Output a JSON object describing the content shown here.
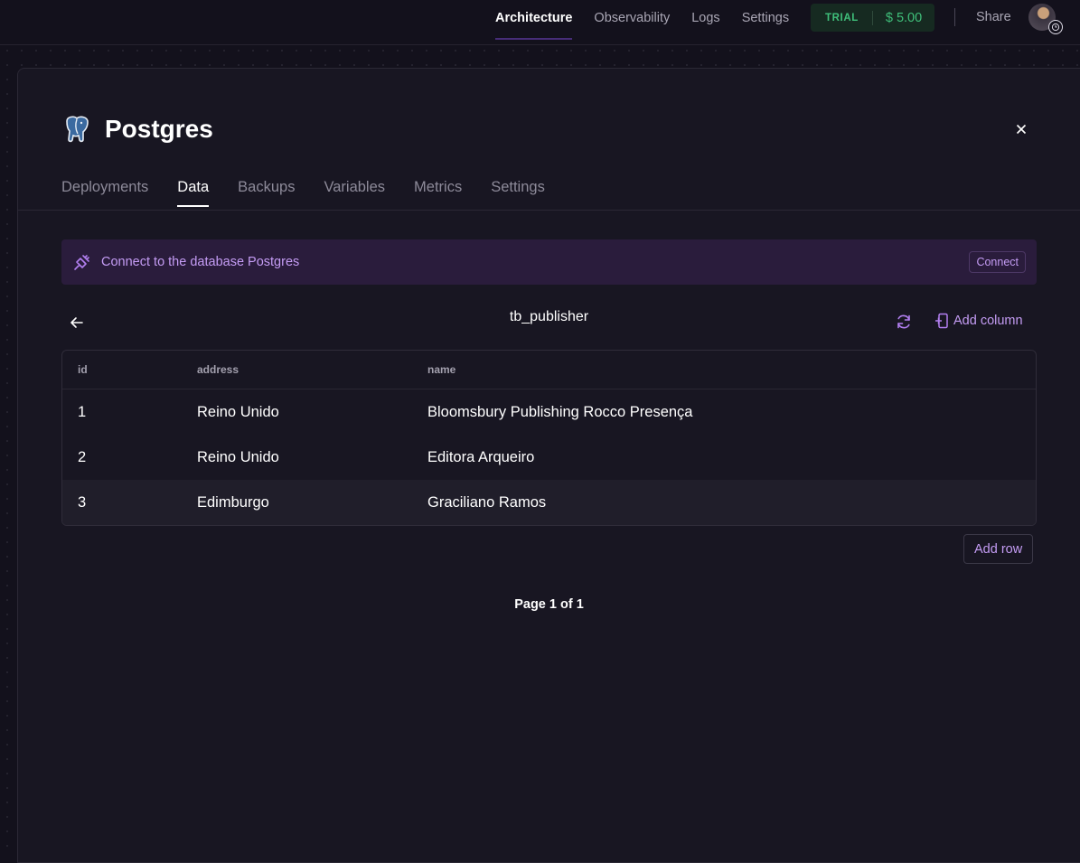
{
  "topnav": {
    "links": [
      "Architecture",
      "Observability",
      "Logs",
      "Settings"
    ],
    "active": "Architecture",
    "trial_label": "TRIAL",
    "trial_amount": "$ 5.00",
    "share_label": "Share"
  },
  "service": {
    "name": "Postgres",
    "tabs": [
      "Deployments",
      "Data",
      "Backups",
      "Variables",
      "Metrics",
      "Settings"
    ],
    "active_tab": "Data"
  },
  "connect_banner": {
    "text": "Connect to the database Postgres",
    "button_label": "Connect"
  },
  "table_view": {
    "table_name": "tb_publisher",
    "add_column_label": "Add column",
    "columns": [
      "id",
      "address",
      "name"
    ],
    "rows": [
      [
        "1",
        "Reino Unido",
        "Bloomsbury Publishing Rocco Presença"
      ],
      [
        "2",
        "Reino Unido",
        "Editora Arqueiro"
      ],
      [
        "3",
        "Edimburgo",
        "Graciliano Ramos"
      ]
    ],
    "add_row_label": "Add row",
    "pagination": "Page 1 of 1"
  },
  "icons": {
    "back": "arrow-left-icon",
    "refresh": "refresh-icon",
    "add_column": "add-column-icon",
    "connect": "plug-icon",
    "close": "close-icon",
    "logo": "postgres-elephant-icon"
  },
  "colors": {
    "accent": "#c49cf4",
    "trial_green": "#3fbf7a",
    "banner_bg": "#2a1c3c"
  }
}
